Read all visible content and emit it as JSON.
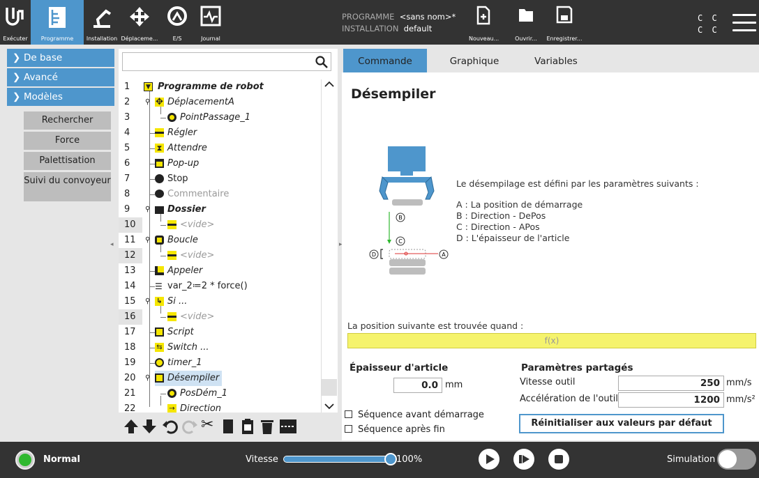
{
  "topbar": {
    "nav": [
      {
        "label": "Exécuter",
        "icon": "ur-logo-icon"
      },
      {
        "label": "Programme",
        "icon": "program-tree-icon",
        "active": true
      },
      {
        "label": "Installation",
        "icon": "robot-arm-icon"
      },
      {
        "label": "Déplaceme...",
        "icon": "move-arrows-icon"
      },
      {
        "label": "E/S",
        "icon": "io-icon"
      },
      {
        "label": "Journal",
        "icon": "log-pulse-icon"
      }
    ],
    "program_label": "PROGRAMME",
    "program_value": "<sans nom>*",
    "installation_label": "INSTALLATION",
    "installation_value": "default",
    "file_buttons": [
      {
        "label": "Nouveau...",
        "icon": "new-file-icon"
      },
      {
        "label": "Ouvrir...",
        "icon": "open-folder-icon"
      },
      {
        "label": "Enregistrer...",
        "icon": "save-disk-icon"
      }
    ],
    "cc_line1": "C C",
    "cc_line2": "C C",
    "menu_icon": "hamburger-menu-icon"
  },
  "sidebar": {
    "headers": [
      {
        "label": "De base",
        "arrow": "›"
      },
      {
        "label": "Avancé",
        "arrow": "›"
      },
      {
        "label": "Modèles",
        "arrow": "⌄"
      }
    ],
    "items": [
      "Rechercher",
      "Force",
      "Palettisation",
      "Suivi du convoyeur"
    ]
  },
  "tree": {
    "search_placeholder": "",
    "rows": [
      {
        "n": "1",
        "text": "Programme de robot",
        "icon": "triangle-down-icon",
        "bold": true
      },
      {
        "n": "2",
        "text": "DéplacementA",
        "icon": "move-icon"
      },
      {
        "n": "3",
        "text": "PointPassage_1",
        "icon": "waypoint-icon"
      },
      {
        "n": "4",
        "text": "Régler",
        "icon": "set-icon"
      },
      {
        "n": "5",
        "text": "Attendre",
        "icon": "hourglass-icon"
      },
      {
        "n": "6",
        "text": "Pop-up",
        "icon": "popup-icon"
      },
      {
        "n": "7",
        "text": "Stop",
        "icon": "stop-hand-icon"
      },
      {
        "n": "8",
        "text": "Commentaire",
        "icon": "comment-icon"
      },
      {
        "n": "9",
        "text": "Dossier",
        "icon": "folder-icon",
        "bold": true
      },
      {
        "n": "10",
        "text": "<vide>",
        "icon": "empty-icon"
      },
      {
        "n": "11",
        "text": "Boucle",
        "icon": "loop-icon"
      },
      {
        "n": "12",
        "text": "<vide>",
        "icon": "empty-icon"
      },
      {
        "n": "13",
        "text": "Appeler",
        "icon": "call-icon"
      },
      {
        "n": "14",
        "text": "var_2≔2 * force()",
        "icon": "assignment-icon"
      },
      {
        "n": "15",
        "text": "Si ...",
        "icon": "if-icon"
      },
      {
        "n": "16",
        "text": "<vide>",
        "icon": "empty-icon"
      },
      {
        "n": "17",
        "text": "Script",
        "icon": "script-icon"
      },
      {
        "n": "18",
        "text": "Switch ...",
        "icon": "switch-icon"
      },
      {
        "n": "19",
        "text": "timer_1",
        "icon": "timer-icon"
      },
      {
        "n": "20",
        "text": "Désempiler",
        "icon": "destack-icon"
      },
      {
        "n": "21",
        "text": "PosDém_1",
        "icon": "waypoint-icon"
      },
      {
        "n": "22",
        "text": "Direction",
        "icon": "direction-icon"
      }
    ],
    "toolbar_icons": [
      "move-up-icon",
      "move-down-icon",
      "undo-icon",
      "redo-icon",
      "cut-icon",
      "copy-icon",
      "paste-icon",
      "delete-icon",
      "suppress-icon"
    ]
  },
  "right": {
    "tabs": [
      "Commande",
      "Graphique",
      "Variables"
    ],
    "title": "Désempiler",
    "desc_intro": "Le désempilage est défini par les paramètres suivants :",
    "desc_lines": [
      "A : La position de démarrage",
      "B : Direction - DePos",
      "C : Direction - APos",
      "D : L'épaisseur de l'article"
    ],
    "diagram_labels": {
      "a": "A",
      "b": "B",
      "c": "C",
      "d": "D"
    },
    "next_pos_label": "La position suivante est trouvée quand :",
    "fx_placeholder": "f(x)",
    "thickness_title": "Épaisseur d'article",
    "thickness_value": "0.0",
    "thickness_unit": "mm",
    "chk_before": "Séquence avant démarrage",
    "chk_after": "Séquence après fin",
    "shared_title": "Paramètres partagés",
    "tool_speed_label": "Vitesse outil",
    "tool_speed_value": "250",
    "tool_speed_unit": "mm/s",
    "tool_accel_label": "Accélération de l'outil",
    "tool_accel_value": "1200",
    "tool_accel_unit": "mm/s²",
    "reset_label": "Réinitialiser aux valeurs par défaut"
  },
  "bottombar": {
    "status": "Normal",
    "speed_label": "Vitesse",
    "speed_value": "100%",
    "speed_fraction": 1.0,
    "sim_label": "Simulation",
    "colors": {
      "status_ok": "#2eb82e",
      "accent": "#4e96cc"
    }
  }
}
